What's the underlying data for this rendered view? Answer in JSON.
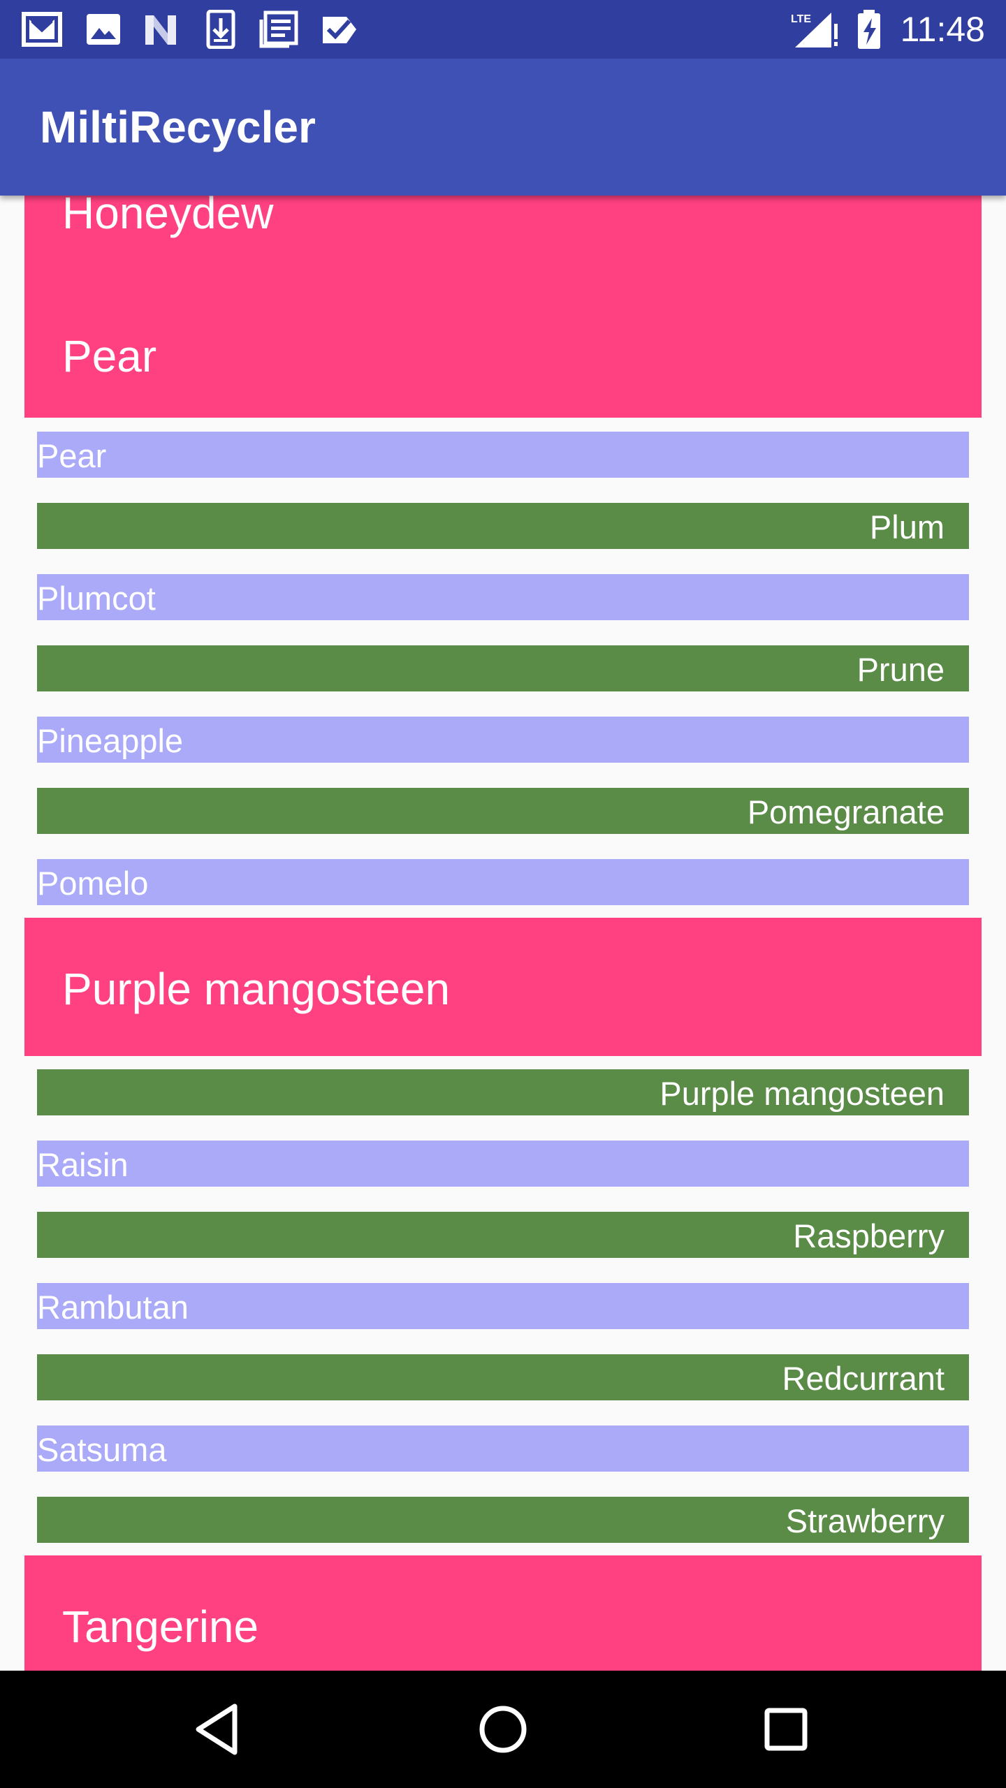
{
  "status_bar": {
    "time": "11:48",
    "network": "LTE",
    "notification_icons": [
      "gmail-icon",
      "image-icon",
      "n-logo-icon",
      "download-icon",
      "newspaper-icon",
      "check-clipboard-icon"
    ],
    "system_icons": [
      "lte-signal-icon",
      "battery-charging-icon"
    ]
  },
  "app_bar": {
    "title": "MiltiRecycler"
  },
  "list": {
    "top_header": {
      "line1": "Honeydew",
      "line2": "Pear"
    },
    "section1_rows": [
      "Pear",
      "Plum",
      "Plumcot",
      "Prune",
      "Pineapple",
      "Pomegranate",
      "Pomelo"
    ],
    "section2_header": "Purple mangosteen",
    "section2_rows": [
      "Purple mangosteen",
      "Raisin",
      "Raspberry",
      "Rambutan",
      "Redcurrant",
      "Satsuma",
      "Strawberry"
    ],
    "section3_header": "Tangerine"
  },
  "nav_bar": {
    "buttons": [
      "back-icon",
      "home-icon",
      "recents-icon"
    ]
  },
  "colors": {
    "status_bar": "#303f9f",
    "app_bar": "#3f51b5",
    "header_card": "#ff4081",
    "row_purple": "#aaaaf8",
    "row_green": "#5a8b47",
    "background": "#fafafa",
    "nav_bar": "#000000"
  }
}
